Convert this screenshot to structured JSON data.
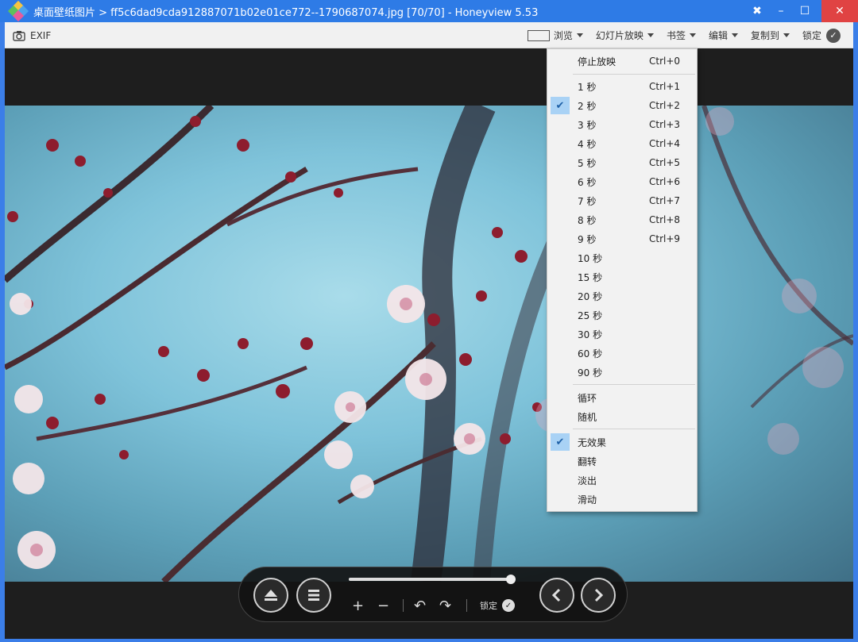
{
  "window": {
    "title": "桌面壁纸图片 > ff5c6dad9cda912887071b02e01ce772--1790687074.jpg [70/70] - Honeyview 5.53",
    "controls": [
      "✖",
      "–",
      "☐",
      "✕"
    ]
  },
  "toolbar": {
    "exif_label": "EXIF",
    "browse_label": "浏览",
    "slideshow_label": "幻灯片放映",
    "bookmark_label": "书签",
    "edit_label": "编辑",
    "copyto_label": "复制到",
    "lock_label": "锁定"
  },
  "menu": {
    "stop": {
      "label": "停止放映",
      "shortcut": "Ctrl+0"
    },
    "intervals": [
      {
        "label": "1 秒",
        "shortcut": "Ctrl+1",
        "checked": false
      },
      {
        "label": "2 秒",
        "shortcut": "Ctrl+2",
        "checked": true
      },
      {
        "label": "3 秒",
        "shortcut": "Ctrl+3",
        "checked": false
      },
      {
        "label": "4 秒",
        "shortcut": "Ctrl+4",
        "checked": false
      },
      {
        "label": "5 秒",
        "shortcut": "Ctrl+5",
        "checked": false
      },
      {
        "label": "6 秒",
        "shortcut": "Ctrl+6",
        "checked": false
      },
      {
        "label": "7 秒",
        "shortcut": "Ctrl+7",
        "checked": false
      },
      {
        "label": "8 秒",
        "shortcut": "Ctrl+8",
        "checked": false
      },
      {
        "label": "9 秒",
        "shortcut": "Ctrl+9",
        "checked": false
      },
      {
        "label": "10 秒",
        "shortcut": "",
        "checked": false
      },
      {
        "label": "15 秒",
        "shortcut": "",
        "checked": false
      },
      {
        "label": "20 秒",
        "shortcut": "",
        "checked": false
      },
      {
        "label": "25 秒",
        "shortcut": "",
        "checked": false
      },
      {
        "label": "30 秒",
        "shortcut": "",
        "checked": false
      },
      {
        "label": "60 秒",
        "shortcut": "",
        "checked": false
      },
      {
        "label": "90 秒",
        "shortcut": "",
        "checked": false
      }
    ],
    "order": [
      {
        "label": "循环",
        "checked": false
      },
      {
        "label": "随机",
        "checked": false
      }
    ],
    "effects": [
      {
        "label": "无效果",
        "checked": true
      },
      {
        "label": "翻转",
        "checked": false
      },
      {
        "label": "淡出",
        "checked": false
      },
      {
        "label": "滑动",
        "checked": false
      }
    ],
    "check_glyph": "✔"
  },
  "bottom_controls": {
    "lock_label": "锁定",
    "progress": 0.97
  },
  "colors": {
    "titlebar": "#2e7be6",
    "close_button": "#e04343",
    "menu_check_bg": "#a9d2f5"
  }
}
